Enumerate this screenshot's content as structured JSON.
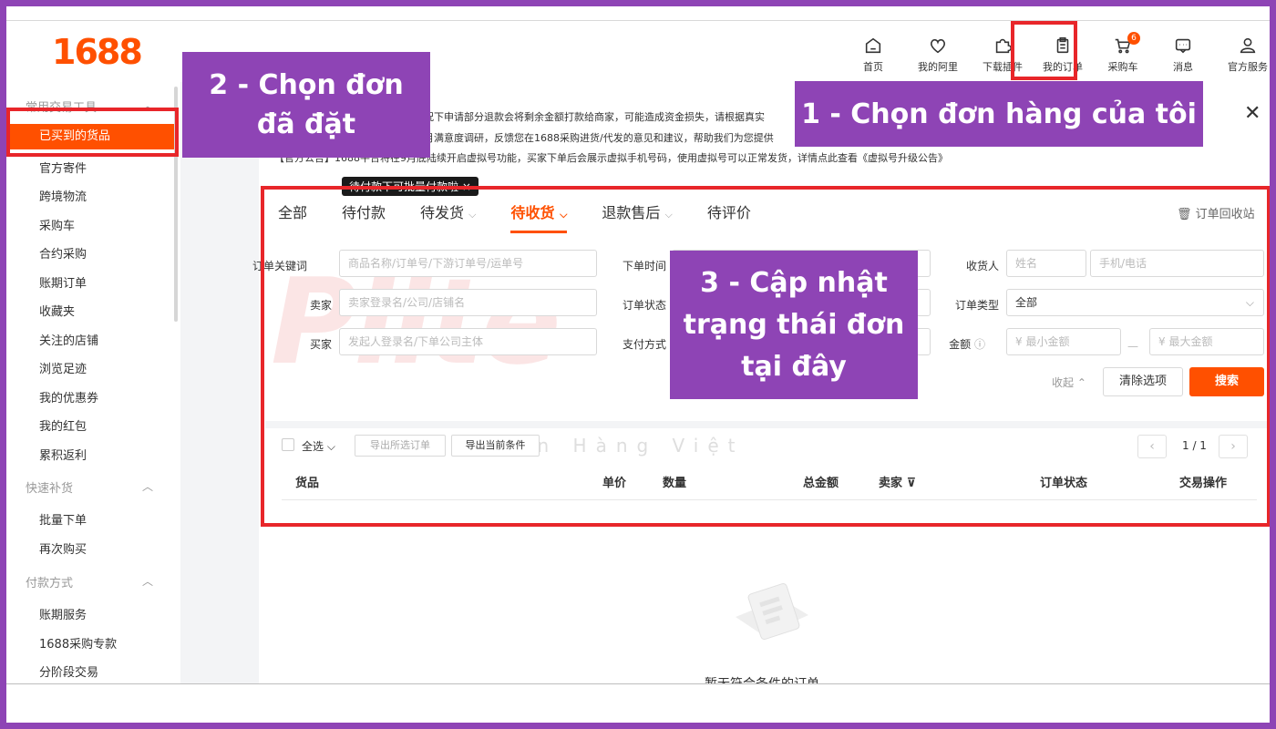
{
  "logo": "1688",
  "top_nav": [
    {
      "label": "首页",
      "icon": "home-icon"
    },
    {
      "label": "我的阿里",
      "icon": "heart-icon"
    },
    {
      "label": "下载插件",
      "icon": "puzzle-icon"
    },
    {
      "label": "我的订单",
      "icon": "clipboard-icon"
    },
    {
      "label": "采购车",
      "icon": "cart-icon",
      "badge": "6"
    },
    {
      "label": "消息",
      "icon": "message-icon"
    },
    {
      "label": "官方服务",
      "icon": "user-icon"
    }
  ],
  "sidebar": {
    "sections": [
      "常用交易工具",
      "快速补货",
      "付款方式"
    ],
    "items": [
      "已买到的货品",
      "官方寄件",
      "跨境物流",
      "采购车",
      "合约采购",
      "账期订单",
      "收藏夹",
      "关注的店铺",
      "浏览足迹",
      "我的优惠券",
      "我的红包",
      "累积返利",
      "批量下单",
      "再次购买",
      "账期服务",
      "1688采购专款",
      "分阶段交易"
    ]
  },
  "notices": [
    "况下申请部分退款会将剩余金额打款给商家，可能造成资金损失，请根据真实",
    "月满意度调研，反馈您在1688采购进货/代发的意见和建议，帮助我们为您提供",
    "【官方公告】1688平台将在9月底陆续开启虚拟号功能，买家下单后会展示虚拟手机号码，使用虚拟号可以正常发货，详情点此查看《虚拟号升级公告》"
  ],
  "tooltip": "待付款下可批量付款啦 ×",
  "tabs": [
    {
      "label": "全部",
      "chev": ""
    },
    {
      "label": "待付款",
      "chev": ""
    },
    {
      "label": "待发货",
      "chev": "⌵"
    },
    {
      "label": "待收货",
      "chev": "⌵"
    },
    {
      "label": "退款售后",
      "chev": "⌵"
    },
    {
      "label": "待评价",
      "chev": ""
    }
  ],
  "recycle_label": "订单回收站",
  "filters": {
    "keyword_label": "订单关键词",
    "keyword_placeholder": "商品名称/订单号/下游订单号/运单号",
    "seller_label": "卖家",
    "seller_placeholder": "卖家登录名/公司/店铺名",
    "buyer_label": "买家",
    "buyer_placeholder": "发起人登录名/下单公司主体",
    "order_time_label": "下单时间",
    "order_status_label": "订单状态",
    "pay_method_label": "支付方式",
    "receiver_label": "收货人",
    "name_placeholder": "姓名",
    "phone_placeholder": "手机/电话",
    "order_type_label": "订单类型",
    "order_type_value": "全部",
    "amount_label": "金额",
    "min_placeholder": "¥  最小金额",
    "max_placeholder": "¥  最大金额",
    "range_dash": "—",
    "collapse_label": "收起 ⌃",
    "clear_label": "清除选项",
    "search_label": "搜索"
  },
  "list": {
    "select_all": "全选 ⌵",
    "export_selected": "导出所选订单",
    "export_current": "导出当前条件",
    "pager": "1 / 1",
    "prev": "‹",
    "next": "›",
    "columns": [
      "货品",
      "单价",
      "数量",
      "总金额",
      "卖家 ⊽",
      "订单状态",
      "交易操作"
    ],
    "empty": "暂无符合条件的订单"
  },
  "watermark": {
    "main": "Plite",
    "sub": "n Chuyển Hàng Việt"
  },
  "callouts": {
    "step1": "1 - Chọn đơn hàng của tôi",
    "step2_line1": "2 - Chọn đơn",
    "step2_line2": "đã đặt",
    "step3_line1": "3 - Cập nhật",
    "step3_line2": "trạng thái đơn",
    "step3_line3": "tại đây"
  },
  "colors": {
    "accent": "#ff5000",
    "callout": "#8e44b5",
    "highlight": "#e8262a"
  }
}
